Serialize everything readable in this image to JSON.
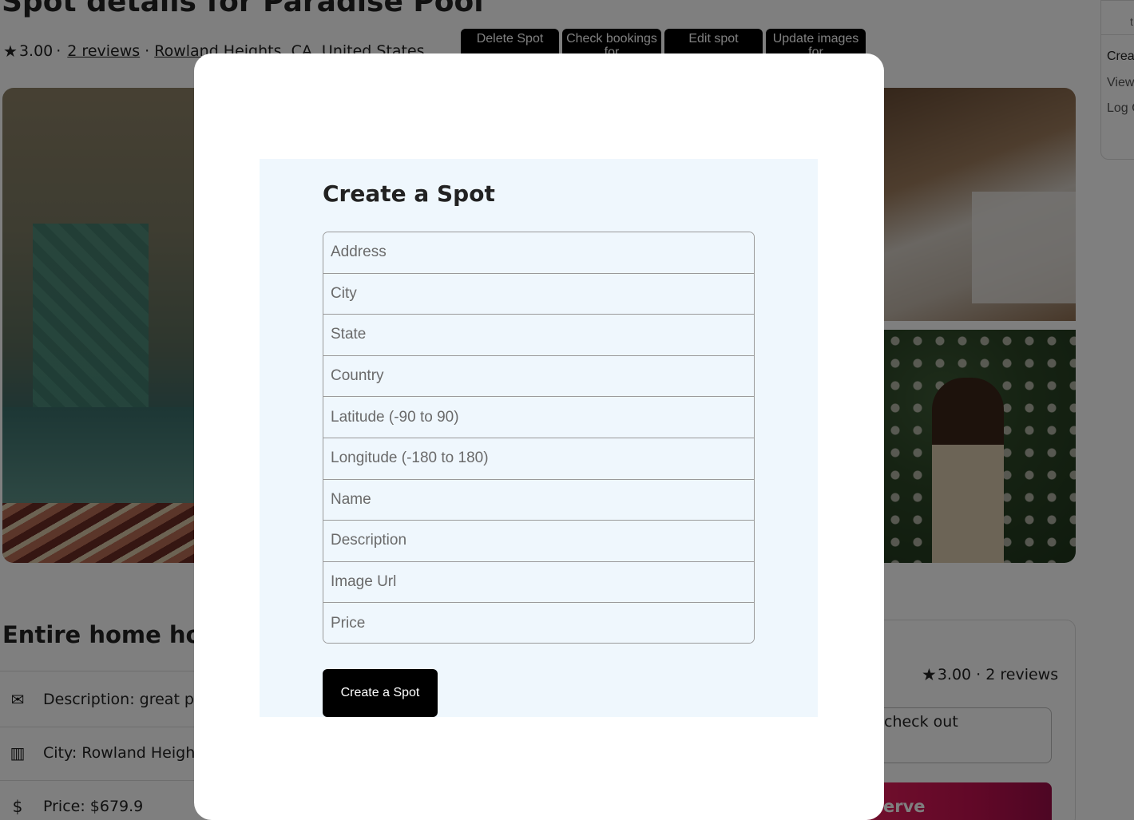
{
  "page": {
    "title": "Spot details for Paradise Pool",
    "rating": "3.00",
    "reviews_link": "2 reviews",
    "location": "Rowland Heights, CA, United States",
    "subtitle": "Entire home hos",
    "description": "Description: great p",
    "city": "City: Rowland Heigh",
    "price": "Price: $679.9"
  },
  "actions": {
    "delete": "Delete Spot",
    "check": "Check bookings for",
    "edit": "Edit spot",
    "update": "Update images for"
  },
  "menu": {
    "top": "t",
    "create": "Crea",
    "view": "View",
    "logout": "Log C"
  },
  "booking": {
    "rating": "3.00 · 2 reviews",
    "dates_label": "check out",
    "reserve": "erve"
  },
  "modal": {
    "title": "Create a Spot",
    "fields": [
      {
        "placeholder": "Address"
      },
      {
        "placeholder": "City"
      },
      {
        "placeholder": "State"
      },
      {
        "placeholder": "Country"
      },
      {
        "placeholder": "Latitude (-90 to 90)"
      },
      {
        "placeholder": "Longitude (-180 to 180)"
      },
      {
        "placeholder": "Name"
      },
      {
        "placeholder": "Description"
      },
      {
        "placeholder": "Image Url"
      },
      {
        "placeholder": "Price"
      }
    ],
    "submit": "Create a Spot"
  },
  "icons": {
    "star": "star-icon",
    "envelope": "envelope-icon",
    "city": "city-icon",
    "dollar": "dollar-icon"
  }
}
